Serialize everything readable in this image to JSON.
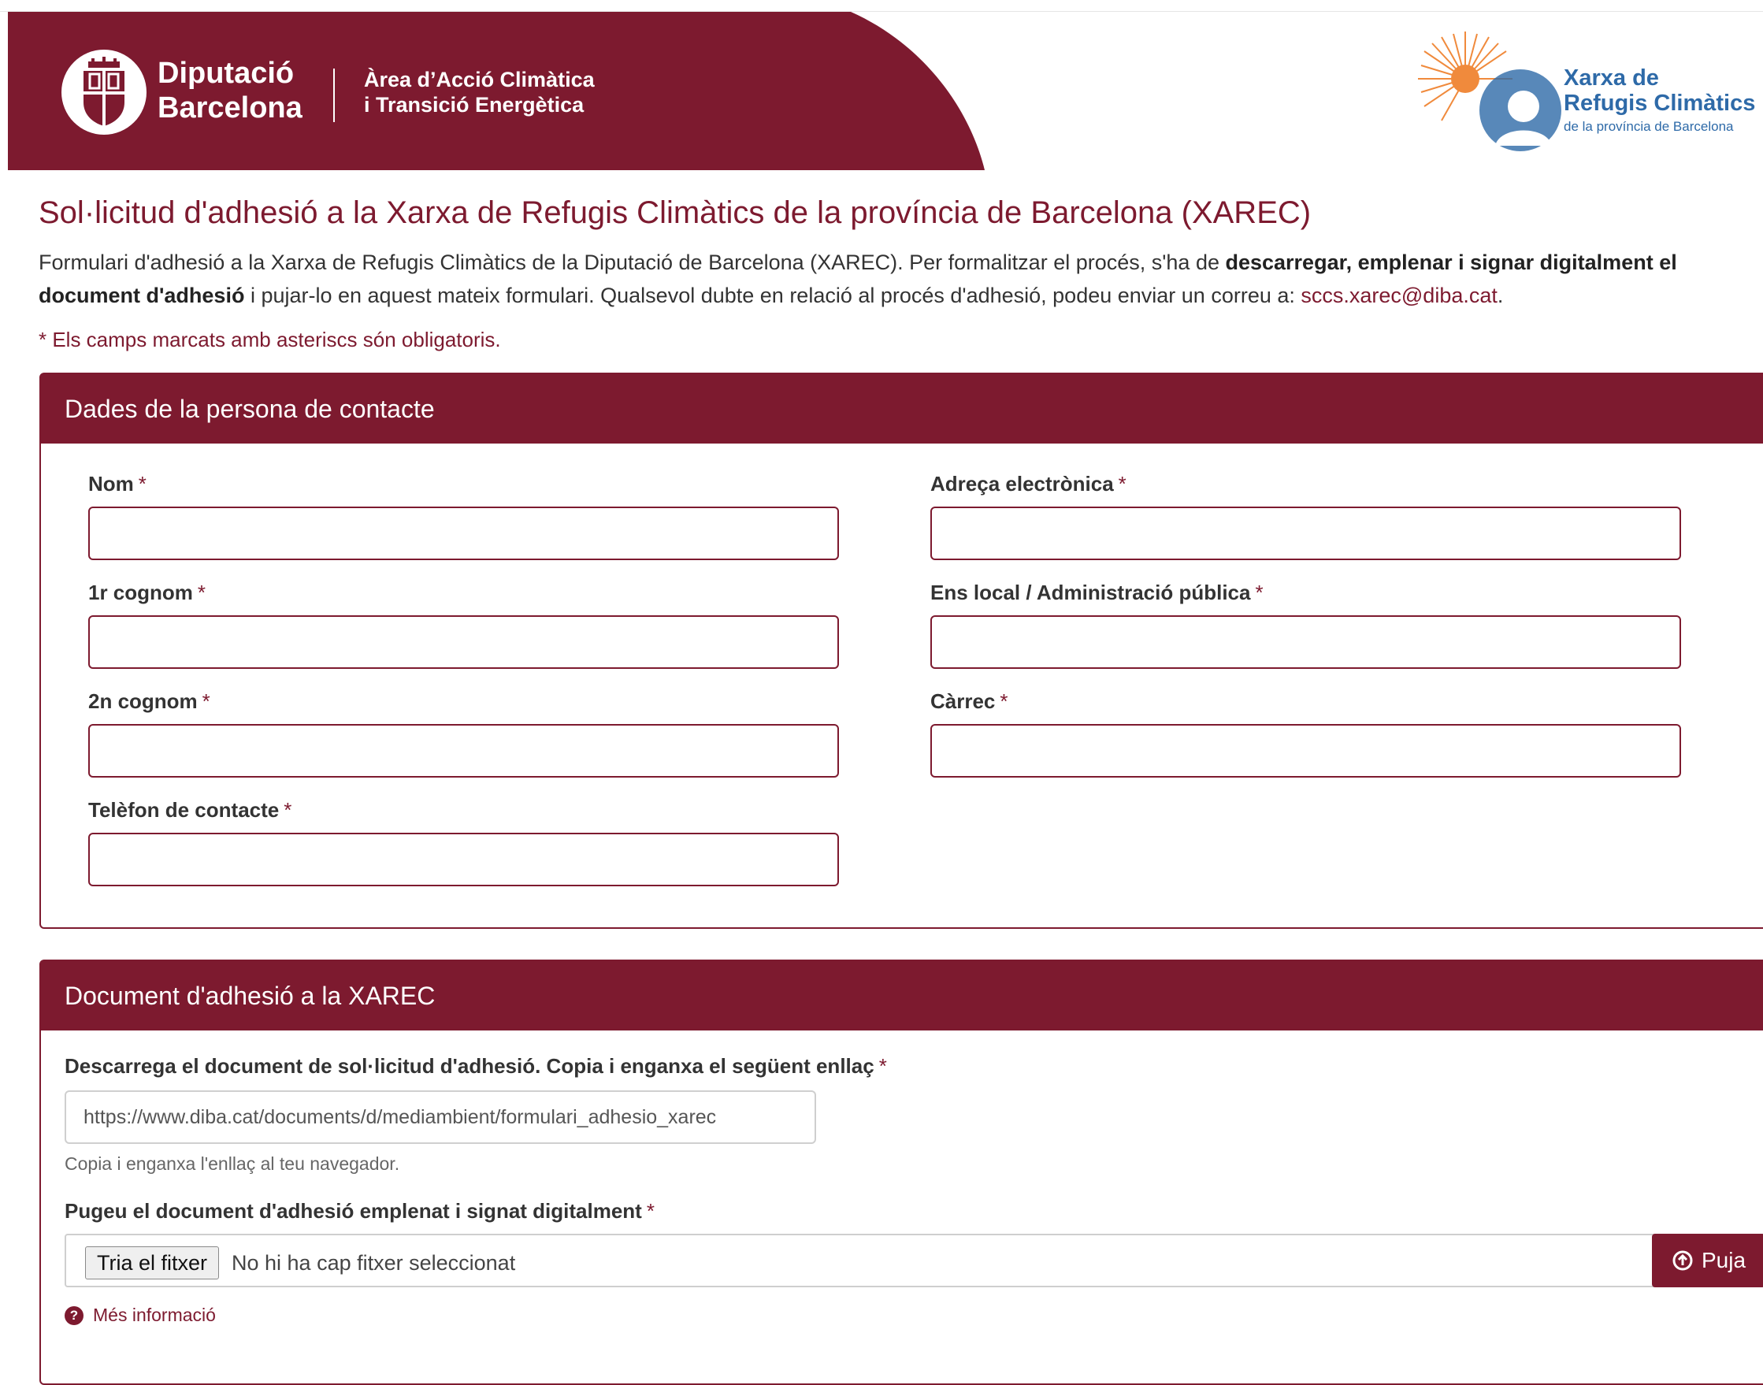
{
  "header": {
    "org_line1": "Diputació",
    "org_line2": "Barcelona",
    "area_line1": "Àrea d’Acció Climàtica",
    "area_line2": "i Transició Energètica",
    "network_line1": "Xarxa de",
    "network_line2": "Refugis Climàtics",
    "network_line3": "de la província de Barcelona"
  },
  "intro": {
    "title": "Sol·licitud d'adhesió a la Xarxa de Refugis Climàtics de la província de Barcelona (XAREC)",
    "text_part1": "Formulari d'adhesió a la Xarxa de Refugis Climàtics de la Diputació de Barcelona (XAREC). Per formalitzar el procés, s'ha de ",
    "text_bold": "descarregar, emplenar i signar digitalment el document d'adhesió",
    "text_part2": " i pujar-lo en aquest mateix formulari. Qualsevol dubte en relació al procés d'adhesió, podeu enviar un correu a: ",
    "email": "sccs.xarec@diba.cat",
    "text_end": ".",
    "required_note": "* Els camps marcats amb asteriscs són obligatoris."
  },
  "contact": {
    "heading": "Dades de la persona de contacte",
    "required_mark": "*",
    "fields": [
      {
        "label": "Nom",
        "value": ""
      },
      {
        "label": "1r cognom",
        "value": ""
      },
      {
        "label": "2n cognom",
        "value": ""
      },
      {
        "label": "Telèfon de contacte",
        "value": ""
      },
      {
        "label": "Adreça electrònica",
        "value": ""
      },
      {
        "label": "Ens local / Administració pública",
        "value": ""
      },
      {
        "label": "Càrrec",
        "value": ""
      }
    ]
  },
  "document": {
    "heading": "Document d'adhesió a la XAREC",
    "download_label": "Descarrega el document de sol·licitud d'adhesió. Copia i enganxa el següent enllaç",
    "link_value": "https://www.diba.cat/documents/d/mediambient/formulari_adhesio_xarec",
    "link_help": "Copia i enganxa l'enllaç al teu navegador.",
    "upload_label": "Pugeu el document d'adhesió emplenat i signat digitalment",
    "choose_file": "Tria el fitxer",
    "no_file": "No hi ha cap fitxer seleccionat",
    "upload_button": "Puja",
    "more_info": "Més informació"
  },
  "colors": {
    "brand": "#7d1a2f",
    "network_blue": "#2e6aa8",
    "sun_orange": "#f08a3c"
  }
}
